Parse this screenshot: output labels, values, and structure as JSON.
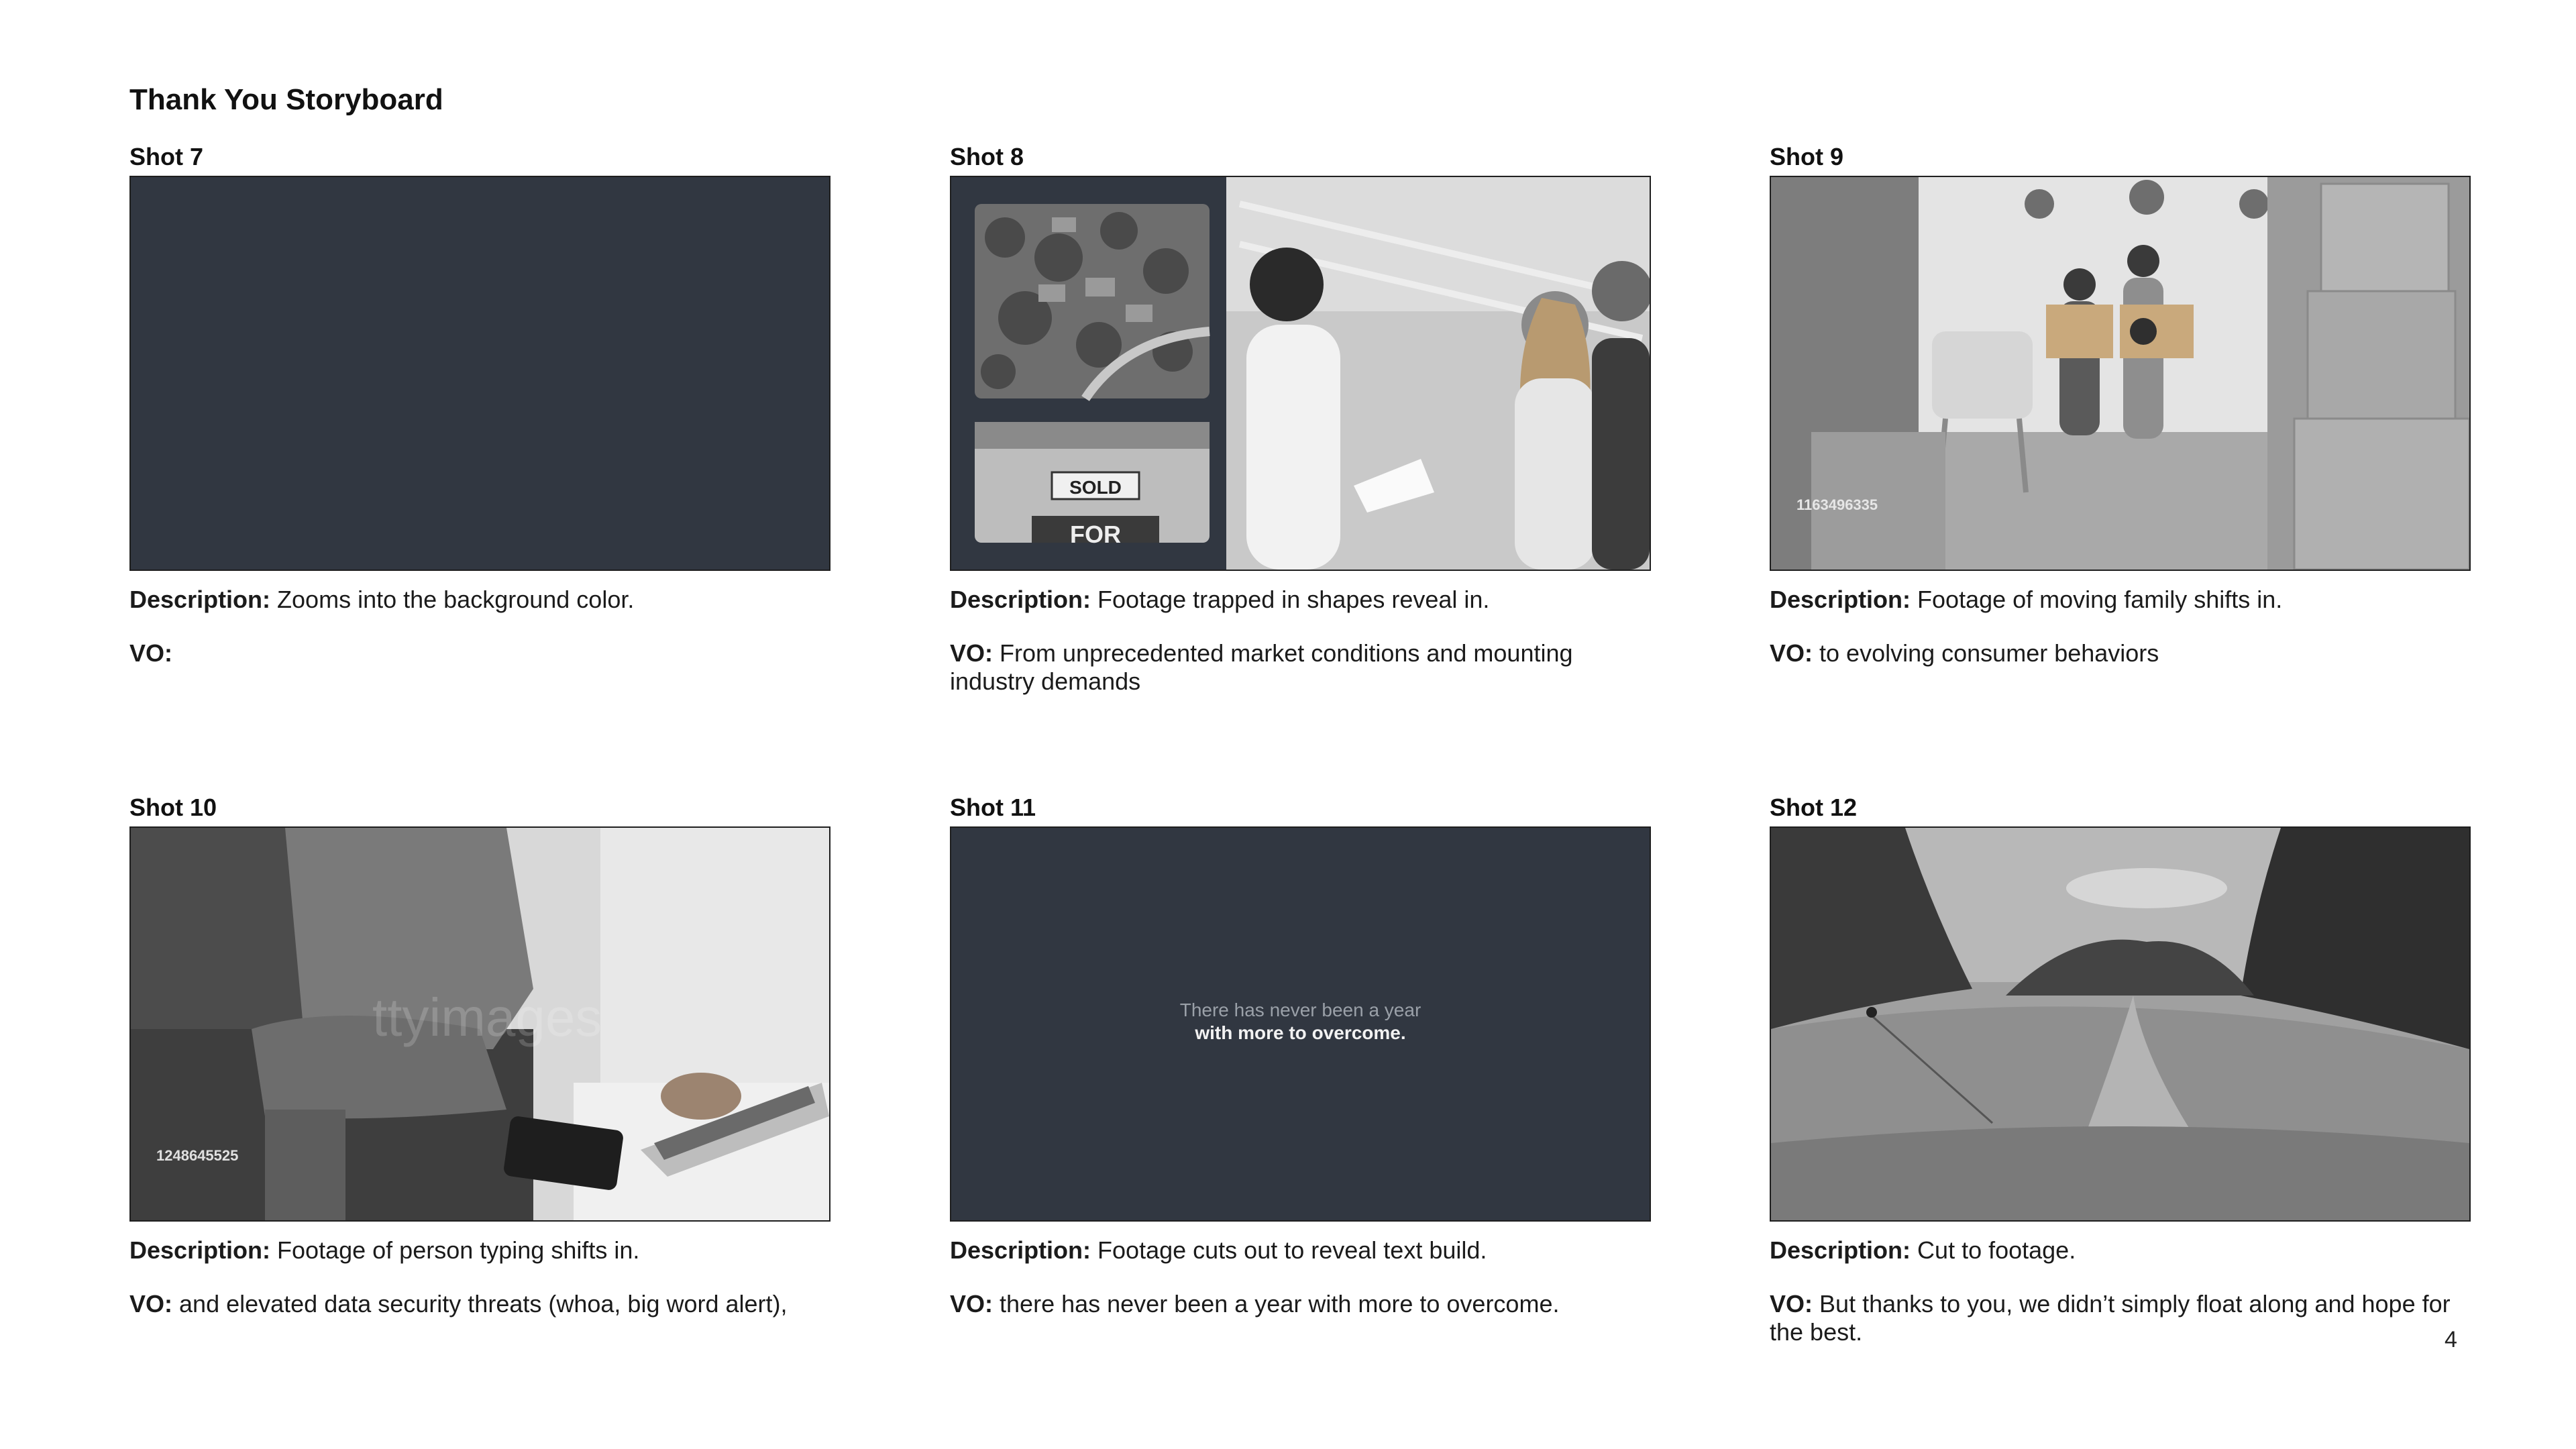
{
  "page": {
    "title": "Thank You Storyboard",
    "number": "4"
  },
  "labels": {
    "description": "Description:",
    "vo": "VO:"
  },
  "shots": [
    {
      "label": "Shot 7",
      "description": "Zooms into the background color.",
      "vo": ""
    },
    {
      "label": "Shot 8",
      "description": "Footage trapped in shapes reveal in.",
      "vo": "From unprecedented market conditions and mounting industry demands",
      "sign_top": "SOLD",
      "sign_bottom": "FOR"
    },
    {
      "label": "Shot 9",
      "description": "Footage of moving family shifts in.",
      "vo": "to evolving consumer behaviors",
      "stock_id": "1163496335"
    },
    {
      "label": "Shot 10",
      "description": "Footage of person typing shifts in.",
      "vo": "and elevated data security threats (whoa, big word alert),",
      "stock_id": "1248645525",
      "watermark": "ttyimages"
    },
    {
      "label": "Shot 11",
      "description": "Footage cuts out to reveal text build.",
      "vo": "there has never been a year with more to overcome.",
      "slide_line1": "There has never been a year",
      "slide_line2": "with more to overcome."
    },
    {
      "label": "Shot 12",
      "description": "Cut to footage.",
      "vo": "But thanks to you, we didn’t simply float along and hope for the best."
    }
  ],
  "colors": {
    "slide_background": "#313741",
    "text": "#1b1b1b"
  }
}
